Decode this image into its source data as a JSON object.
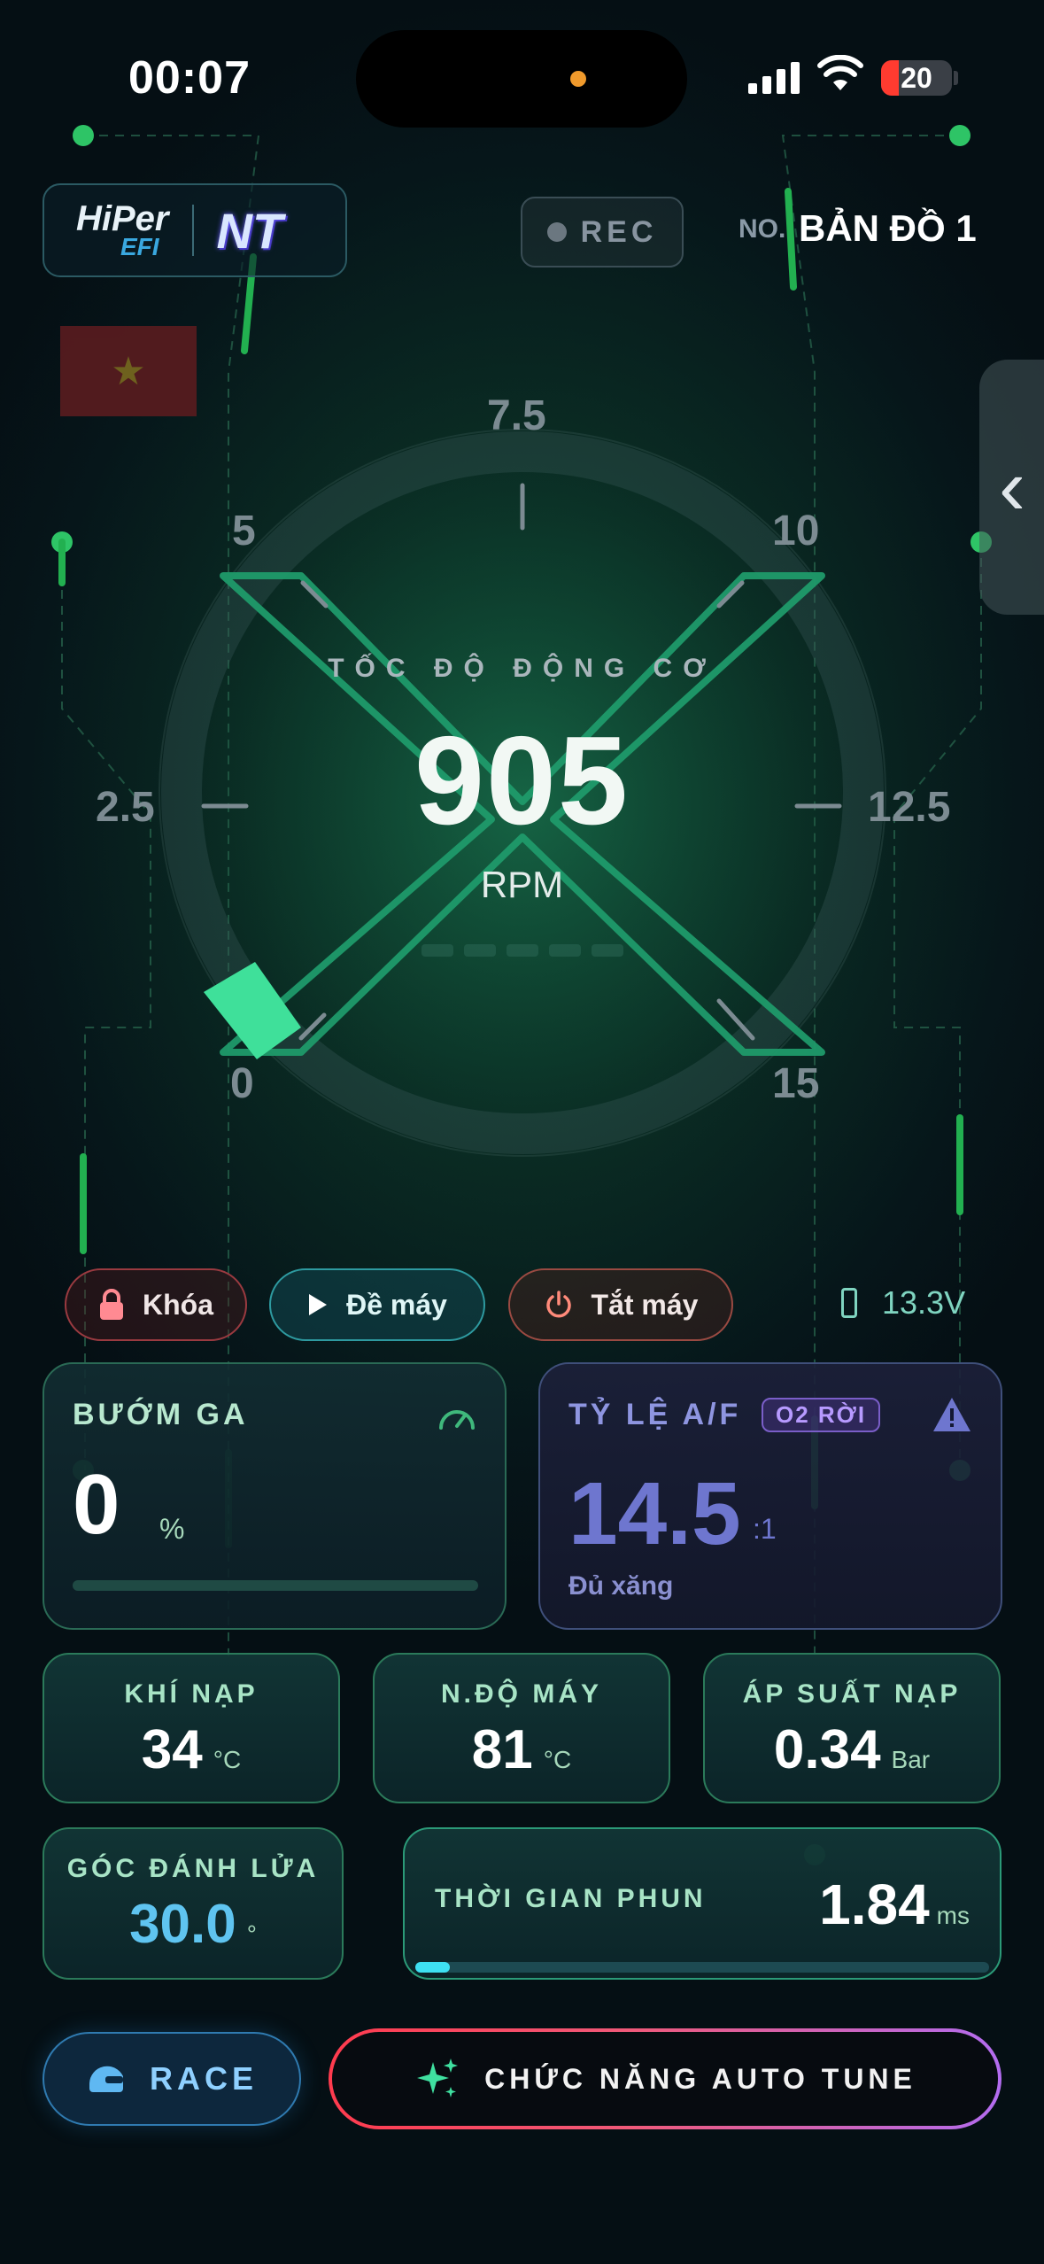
{
  "status_bar": {
    "time": "00:07",
    "battery": "20"
  },
  "header": {
    "logo_hiper": "HiPer",
    "logo_efi": "EFI",
    "logo_nt": "NT",
    "rec_label": "REC",
    "map_prefix": "NO.",
    "map_name": "BẢN ĐỒ 1"
  },
  "gauge": {
    "title": "TỐC ĐỘ ĐỘNG CƠ",
    "value": "905",
    "unit": "RPM",
    "ticks": [
      "0",
      "2.5",
      "5",
      "7.5",
      "10",
      "12.5",
      "15"
    ],
    "min": 0,
    "max": 15,
    "current_k": 0.905
  },
  "controls": {
    "lock": "Khóa",
    "start": "Đề máy",
    "stop": "Tắt máy",
    "voltage": "13.3V"
  },
  "throttle": {
    "title": "BƯỚM GA",
    "value": "0",
    "unit": "%",
    "percent": 0
  },
  "af_ratio": {
    "title": "TỶ LỆ A/F",
    "badge": "O2 RỜI",
    "value": "14.5",
    "unit": ":1",
    "status": "Đủ xăng"
  },
  "sensors": {
    "intake": {
      "label": "KHÍ NẠP",
      "value": "34",
      "unit": "°C"
    },
    "engine": {
      "label": "N.ĐỘ MÁY",
      "value": "81",
      "unit": "°C"
    },
    "map": {
      "label": "ÁP SUẤT NẠP",
      "value": "0.34",
      "unit": "Bar"
    },
    "ignition": {
      "label": "GÓC ĐÁNH LỬA",
      "value": "30.0",
      "unit": "°"
    },
    "injection": {
      "label": "THỜI GIAN PHUN",
      "value": "1.84",
      "unit": "ms",
      "bar_percent": 6
    }
  },
  "bottom": {
    "race": "RACE",
    "auto_tune": "CHỨC NĂNG AUTO TUNE"
  },
  "colors": {
    "accent": "#3fe09a",
    "af": "#6e76cf",
    "injection": "#3ee0f2",
    "race": "#8fd0ff"
  }
}
